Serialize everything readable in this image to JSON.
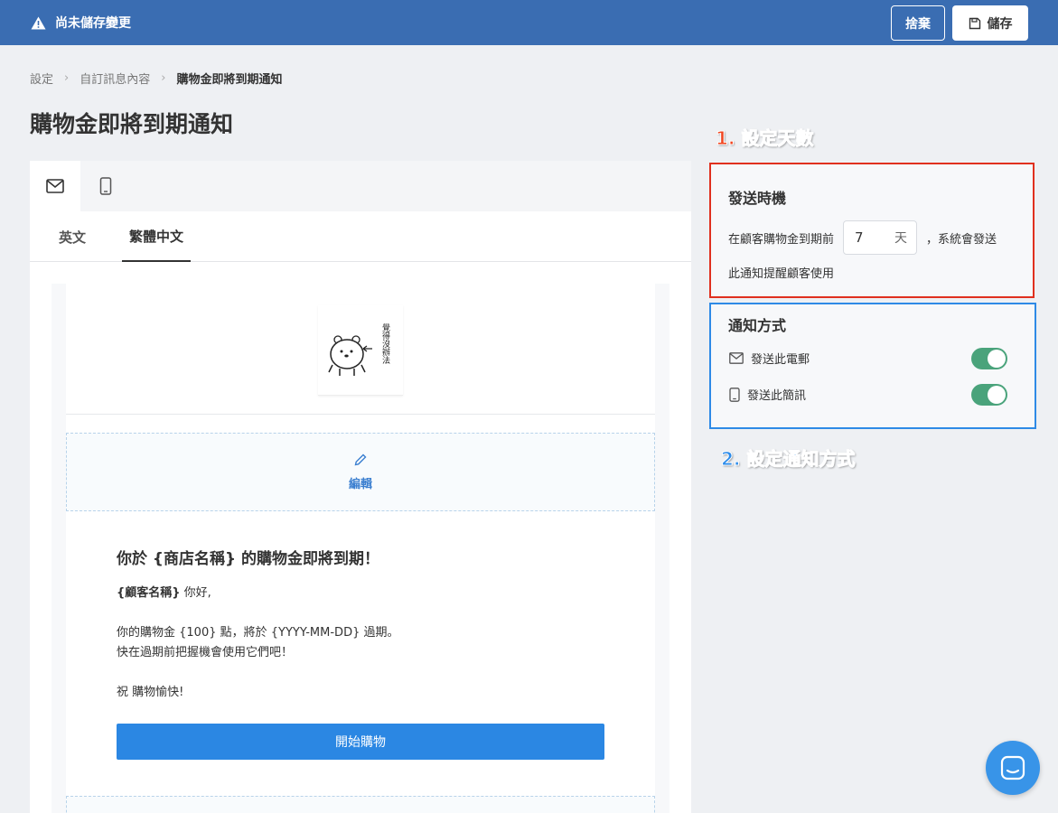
{
  "topbar": {
    "unsaved_text": "尚未儲存變更",
    "discard_label": "捨棄",
    "save_label": "儲存",
    "bg_color": "#3a6db2"
  },
  "breadcrumb": {
    "items": [
      "設定",
      "自訂訊息內容",
      "購物金即將到期通知"
    ]
  },
  "page_title": "購物金即將到期通知",
  "preview": {
    "device_tabs": [
      {
        "icon": "mail-icon",
        "active": true
      },
      {
        "icon": "mobile-icon",
        "active": false
      }
    ],
    "lang_tabs": [
      "英文",
      "繁體中文"
    ],
    "active_lang": "繁體中文",
    "logo_text": "覺得沒辦法",
    "edit_label": "編輯",
    "email": {
      "heading": "你於 {商店名稱} 的購物金即將到期！",
      "greeting_var": "{顧客名稱}",
      "greeting_rest": " 你好,",
      "line1": "你的購物金 {100} 點，將於 {YYYY-MM-DD} 過期。",
      "line2": "快在過期前把握機會使用它們吧！",
      "closing": "祝 購物愉快!",
      "cta_label": "開始購物",
      "cta_color": "#2b87e3"
    }
  },
  "timing": {
    "title": "發送時機",
    "prefix": "在顧客購物金到期前",
    "days_value": "7",
    "days_unit": "天",
    "suffix": "，系統會發送",
    "line2": "此通知提醒顧客使用"
  },
  "notify": {
    "title": "通知方式",
    "email_label": "發送此電郵",
    "sms_label": "發送此簡訊",
    "email_enabled": true,
    "sms_enabled": true,
    "toggle_color": "#4aa37b"
  },
  "annotations": {
    "step1": "1. 設定天數",
    "step2": "2. 設定通知方式",
    "step1_color": "#e0301e",
    "step2_color": "#2e8ae6"
  }
}
